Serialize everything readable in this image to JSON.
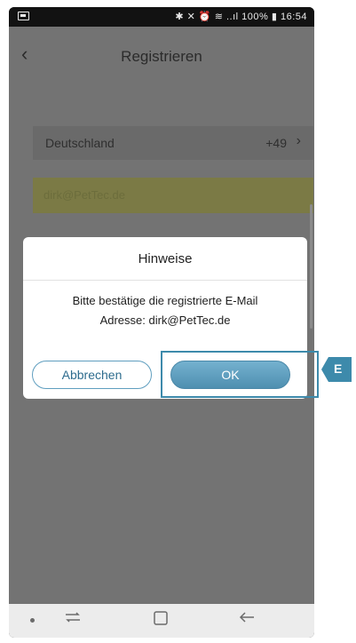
{
  "status_bar": {
    "icons_text": "✱ ✕ ⏰ ≋ ..ıl",
    "battery": "100%",
    "time": "16:54"
  },
  "header": {
    "back_symbol": "‹",
    "title": "Registrieren"
  },
  "form": {
    "country_name": "Deutschland",
    "country_code": "+49",
    "chevron": "›",
    "email_value": "dirk@PetTec.de"
  },
  "dialog": {
    "title": "Hinweise",
    "message_line1": "Bitte bestätige die registrierte E-Mail",
    "message_line2": "Adresse: dirk@PetTec.de",
    "cancel_label": "Abbrechen",
    "ok_label": "OK"
  },
  "annotation": {
    "callout_label": "E",
    "color": "#3d8aab"
  },
  "navbar": {
    "recent_icon": "recent-apps-icon",
    "home_icon": "home-icon",
    "back_icon": "back-arrow-icon"
  }
}
